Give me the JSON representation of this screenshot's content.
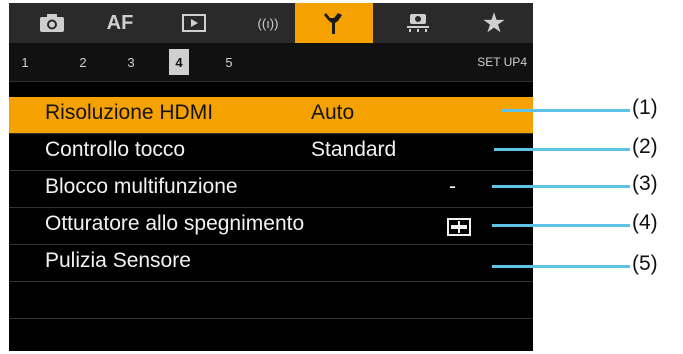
{
  "tabs": [
    {
      "icon": "camera-icon",
      "label": ""
    },
    {
      "icon": "af-icon",
      "label": "AF"
    },
    {
      "icon": "playback-icon",
      "label": ""
    },
    {
      "icon": "wireless-icon",
      "label": "((ı))"
    },
    {
      "icon": "wrench-icon",
      "label": ""
    },
    {
      "icon": "custom-function-icon",
      "label": ""
    },
    {
      "icon": "star-icon",
      "label": "★"
    }
  ],
  "active_tab": 4,
  "pages": [
    "1",
    "2",
    "3",
    "4",
    "5"
  ],
  "active_page": "4",
  "page_id": "SET UP4",
  "menu_items": [
    {
      "label": "Risoluzione HDMI",
      "value": "Auto",
      "selected": true
    },
    {
      "label": "Controllo tocco",
      "value": "Standard",
      "selected": false
    },
    {
      "label": "Blocco multifunzione",
      "value": "-",
      "selected": false
    },
    {
      "label": "Otturatore allo spegnimento",
      "value": "",
      "value_icon": "shutter-icon",
      "selected": false
    },
    {
      "label": "Pulizia Sensore",
      "value": "",
      "selected": false
    }
  ],
  "callouts": [
    "(1)",
    "(2)",
    "(3)",
    "(4)",
    "(5)"
  ],
  "colors": {
    "accent": "#f5a200",
    "callout_line": "#5ec2e9"
  }
}
